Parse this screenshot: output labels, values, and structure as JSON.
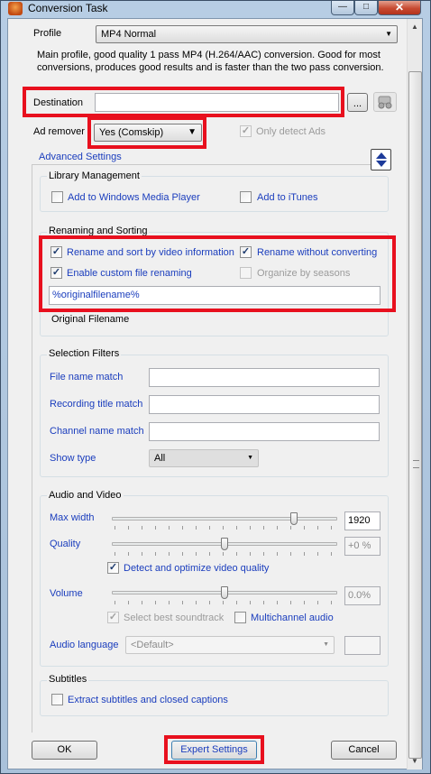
{
  "window": {
    "title": "Conversion Task",
    "minimize_glyph": "—",
    "maximize_glyph": "□",
    "close_glyph": "✕"
  },
  "profile": {
    "label": "Profile",
    "selected": "MP4 Normal",
    "description": "Main profile, good quality 1 pass MP4 (H.264/AAC) conversion. Good for most conversions, produces good results and is faster than the two pass conversion."
  },
  "destination": {
    "label": "Destination",
    "value": "",
    "browse_label": "...",
    "network_icon": "network-drive-icon"
  },
  "ad_remover": {
    "label": "Ad remover",
    "selected": "Yes (Comskip)",
    "only_detect_label": "Only detect Ads",
    "only_detect_checked": true
  },
  "advanced_settings": {
    "label": "Advanced Settings"
  },
  "library": {
    "title": "Library Management",
    "wmp_label": "Add to Windows Media Player",
    "wmp_checked": false,
    "itunes_label": "Add to iTunes",
    "itunes_checked": false
  },
  "renaming": {
    "title": "Renaming and Sorting",
    "rename_sort_label": "Rename and sort by video information",
    "rename_sort_checked": true,
    "rename_without_label": "Rename without converting",
    "rename_without_checked": true,
    "custom_label": "Enable custom file renaming",
    "custom_checked": true,
    "organize_label": "Organize by seasons",
    "organize_checked": false,
    "pattern_value": "%originalfilename%",
    "preview_label": "Original Filename"
  },
  "filters": {
    "title": "Selection Filters",
    "file_name_label": "File name match",
    "file_name_value": "",
    "recording_title_label": "Recording title match",
    "recording_title_value": "",
    "channel_name_label": "Channel name match",
    "channel_name_value": "",
    "show_type_label": "Show type",
    "show_type_selected": "All"
  },
  "audio_video": {
    "title": "Audio and Video",
    "max_width_label": "Max width",
    "max_width_value": "1920",
    "max_width_level": 0.82,
    "quality_label": "Quality",
    "quality_value": "+0 %",
    "quality_level": 0.5,
    "detect_label": "Detect and optimize video quality",
    "detect_checked": true,
    "volume_label": "Volume",
    "volume_value": "0.0%",
    "volume_level": 0.5,
    "soundtrack_label": "Select best soundtrack",
    "soundtrack_checked": true,
    "multichannel_label": "Multichannel audio",
    "multichannel_checked": false,
    "language_label": "Audio language",
    "language_selected": "<Default>"
  },
  "subtitles": {
    "title": "Subtitles",
    "extract_label": "Extract subtitles and closed captions",
    "extract_checked": false
  },
  "buttons": {
    "ok": "OK",
    "expert": "Expert Settings",
    "cancel": "Cancel"
  },
  "colors": {
    "highlight_border": "#e8101e",
    "link_blue": "#1a3dbd"
  }
}
